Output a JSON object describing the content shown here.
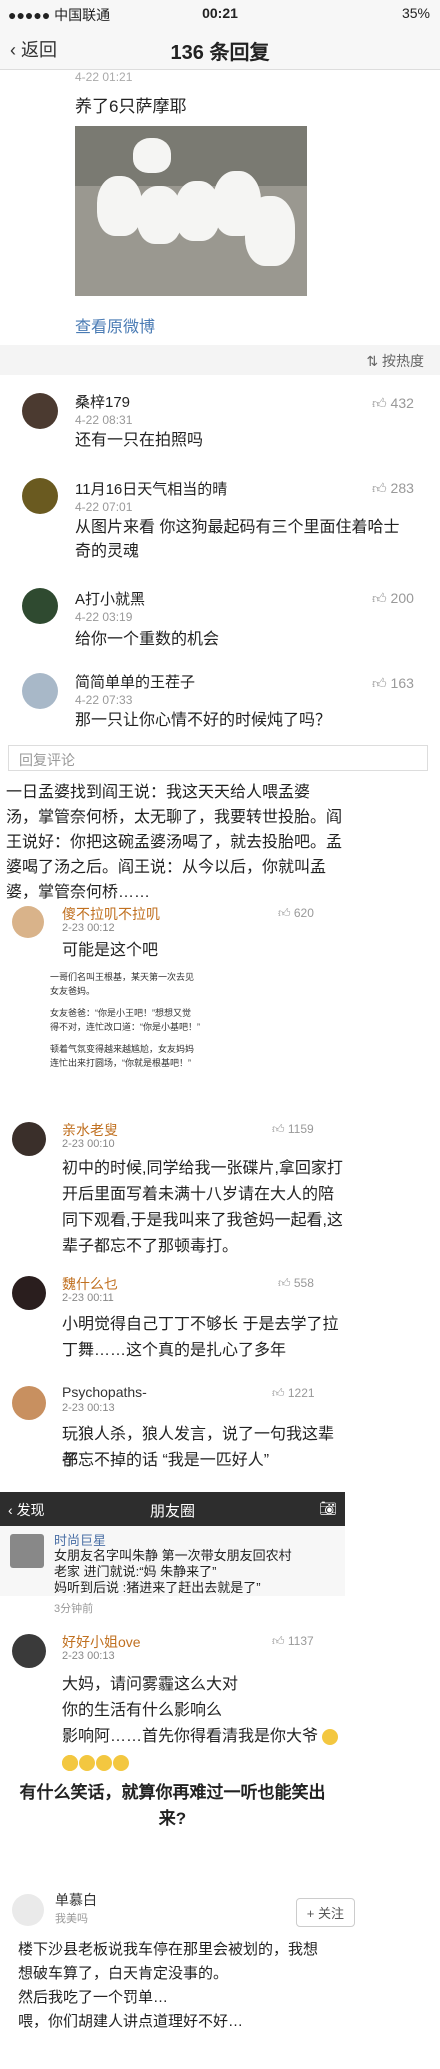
{
  "status": {
    "carrier": "●●●●● 中国联通",
    "time": "00:21",
    "battery": "35%"
  },
  "nav": {
    "back": "返回",
    "title": "136 条回复"
  },
  "post": {
    "time": "4-22 01:21",
    "text": "养了6只萨摩耶",
    "orig_link": "查看原微博"
  },
  "sort": {
    "label": "按热度"
  },
  "comments": [
    {
      "name": "桑梓179",
      "time": "4-22 08:31",
      "text": "还有一只在拍照吗",
      "likes": "432"
    },
    {
      "name": "11月16日天气相当的晴",
      "time": "4-22 07:01",
      "text1": "从图片来看 你这狗最起码有三个里面住着哈士",
      "text2": "奇的灵魂",
      "likes": "283"
    },
    {
      "name": "A打小就黑",
      "time": "4-22 03:19",
      "text": "给你一个重数的机会",
      "likes": "200"
    },
    {
      "name": "简简单单的王茬子",
      "time": "4-22 07:33",
      "text": "那一只让你心情不好的时候炖了吗？",
      "likes": "163"
    }
  ],
  "reply": {
    "placeholder": "回复评论"
  },
  "story": {
    "l1": "    一日孟婆找到阎王说：我这天天给人喂孟婆",
    "l2": "汤，掌管奈何桥，太无聊了，我要转世投胎。阎",
    "l3": "王说好：你把这碗孟婆汤喝了，就去投胎吧。孟",
    "l4": "婆喝了汤之后。阎王说：从今以后，你就叫孟",
    "l5": "婆，掌管奈何桥……"
  },
  "s2": [
    {
      "name": "傻不拉叽不拉叽",
      "time": "2-23 00:12",
      "likes": "620",
      "text": "可能是这个吧"
    },
    {
      "name": "亲水老叟",
      "time": "2-23 00:10",
      "likes": "1159",
      "l1": "初中的时候,同学给我一张碟片,拿回家打",
      "l2": "开后里面写着未满十八岁请在大人的陪",
      "l3": "同下观看,于是我叫来了我爸妈一起看,这",
      "l4": "辈子都忘不了那顿毒打。"
    },
    {
      "name": "魏什么乜",
      "time": "2-23 00:11",
      "likes": "558",
      "l1": "小明觉得自己丁丁不够长 于是去学了拉",
      "l2": "丁舞……这个真的是扎心了多年"
    },
    {
      "name": "Psychopaths-",
      "time": "2-23 00:13",
      "likes": "1221",
      "l1": "玩狼人杀，狼人发言，说了一句我这辈子",
      "l2": "都忘不掉的话 “我是一匹好人”"
    }
  ],
  "inner": {
    "l1": "一哥们名叫王根基，某天第一次去见",
    "l2": "女友爸妈。",
    "l3": "女友爸爸：“你是小王吧！”想想又觉",
    "l4": "得不对，连忙改口道：“你是小基吧！”",
    "l5": "顿着气氛变得越来越尴尬，女友妈妈",
    "l6": "连忙出来打圆场，“你就是根基吧！”"
  },
  "wechat": {
    "back": "发现",
    "title": "朋友圈",
    "name": "时尚巨星",
    "l1": "女朋友名字叫朱静 第一次带女朋友回农村",
    "l2": "老家 进门就说:“妈 朱静来了”",
    "l3": "妈听到后说 :猪进来了赶出去就是了”",
    "time": "3分钟前"
  },
  "s3": {
    "name": "好好小姐ove",
    "time": "2-23 00:13",
    "likes": "1137",
    "l1": "大妈，请问雾霾这么大对",
    "l2": "你的生活有什么影响么",
    "l3": "影响阿……首先你得看清我是你大爷"
  },
  "question": {
    "l1": "有什么笑话，就算你再难过一听也能笑出",
    "l2": "来?"
  },
  "last": {
    "name": "单慕白",
    "follow": "+ 关注",
    "sub": "我美吗",
    "l1": "楼下沙县老板说我车停在那里会被划的，我想",
    "l2": "想破车算了，白天肯定没事的。",
    "l3": "然后我吃了一个罚单…",
    "l4": "喂，你们胡建人讲点道理好不好…"
  },
  "colors": {
    "link": "#4a7bb4",
    "navbg": "#f7f7f7",
    "wechatbar": "#2d2d2d"
  }
}
